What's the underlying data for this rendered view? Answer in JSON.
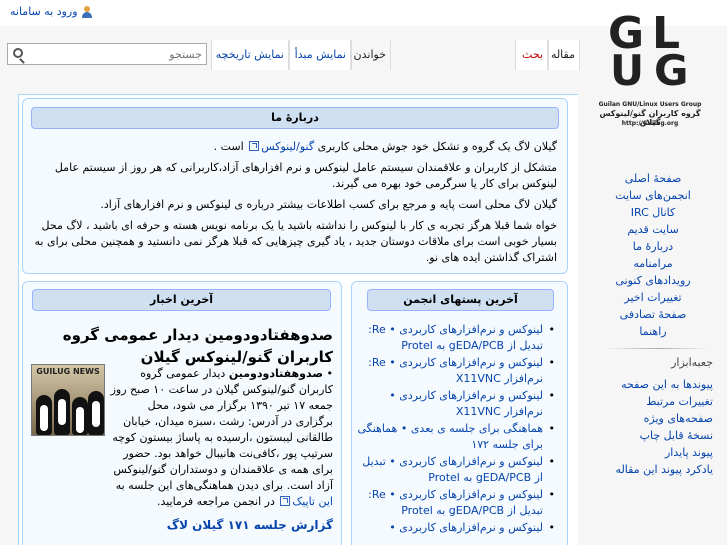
{
  "personal": {
    "login": "ورود به سامانه"
  },
  "logo": {
    "letters": [
      "G",
      "U",
      "L",
      "G"
    ],
    "caption_en": "Guilan GNU/Linux Users Group",
    "caption_fa": "گروه کاربران گنو/لینوکس گیلان",
    "url": "http://Guilug.org"
  },
  "tabs": {
    "article": "مقاله",
    "talk": "بحث",
    "read": "خواندن",
    "source": "نمایش مبدأ",
    "history": "نمایش تاریخچه"
  },
  "search": {
    "placeholder": "جستجو"
  },
  "about": {
    "title": "دربارهٔ ما",
    "p1_before": "گیلان لاگ یک گروه و تشکل خود جوش محلی کاربری",
    "p1_link": "گنو/لینوکس",
    "p1_after": "است .",
    "p2": "متشکل از کاربران و علاقمندان سیستم عامل لینوکس و نرم افزارهای آزاد،کاربرانی که هر روز از سیستم عامل لینوکس برای کار یا سرگرمی خود بهره می گیرند.",
    "p3": "گیلان لاگ محلی است پایه و مرجع برای کسب اطلاعات بیشتر درباره ی لینوکس و نرم افزارهای آزاد.",
    "p4": "خواه شما قبلا هرگز تجربه ی کار با لینوکس را نداشته باشید یا یک برنامه نویس هسته و حرفه ای باشید ، لاگ محل بسیار خوبی است برای ملاقات دوستان جدید ، یاد گیری چیزهایی که قبلا هرگز نمی دانستید و همچنین محلی برای به اشتراک گذاشتن ایده های نو."
  },
  "forum": {
    "title": "آخرین پستهای انجمن",
    "items": [
      "لینوکس و نرم‌افزارهای کاربردی • Re: تبدیل از gEDA/PCB به Protel",
      "لینوکس و نرم‌افزارهای کاربردی • Re: نرم‌افزار X11VNC",
      "لینوکس و نرم‌افزارهای کاربردی • نرم‌افزار X11VNC",
      "هماهنگی برای جلسه ی بعدی • هماهنگی برای جلسه ۱۷۲",
      "لینوکس و نرم‌افزارهای کاربردی • تبدیل از gEDA/PCB به Protel",
      "لینوکس و نرم‌افزارهای کاربردی • Re: تبدیل از gEDA/PCB به Protel",
      "لینوکس و نرم‌افزارهای کاربردی •"
    ]
  },
  "news": {
    "title": "آخرین اخبار",
    "headline": "صدوهفتادودومین دیدار عمومی گروه کاربران گنو/لینوکس گیلان",
    "thumb_text": "GUILUG NEWS",
    "item_bold": "صدوهفتادودومین",
    "item_rest": "دیدار عمومی گروه کاربران گنو/لینوکس گیلان در ساعت ۱۰ صبح روز جمعه ۱۷ تیر ۱۳۹۰ برگزار می شود، محل برگزاری در آدرس: رشت ،سبزه میدان، خیابان طالقانی لیبستون ،ارسیده به پاساژ بیستون کوچه سرتیپ پور ،کافی‌نت هانیبال خواهد بود. حضور برای همه ی علاقمندان و دوستداران گنو/لینوکس آزاد است. برای دیدن هماهنگی‌های این جلسه به",
    "item_link": "این تاپیک",
    "item_tail": "در انجمن مراجعه فرمایید.",
    "report": "گزارش جلسه ۱۷۱ گیلان لاگ"
  },
  "sidebar": {
    "nav": [
      "صفحهٔ اصلی",
      "انجمن‌های سایت",
      "کانال IRC",
      "سایت قدیم",
      "دربارهٔ ما",
      "مرامنامه",
      "رویدادهای کنونی",
      "تغییرات اخیر",
      "صفحهٔ تصادفی",
      "راهنما"
    ],
    "toolbox_title": "جعبه‌ابزار",
    "toolbox": [
      "پیوندها به این صفحه",
      "تغییرات مرتبط",
      "صفحه‌های ویژه",
      "نسخهٔ قابل چاپ",
      "پیوند پایدار",
      "یادکرد پیوند این مقاله"
    ]
  }
}
